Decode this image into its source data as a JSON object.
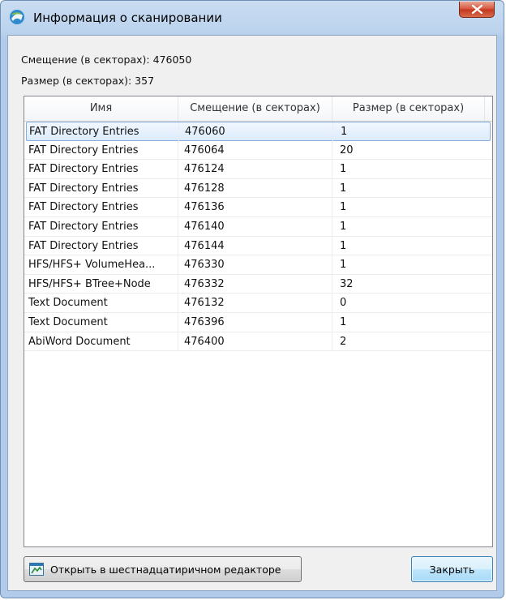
{
  "window": {
    "title": "Информация о сканировании",
    "close_icon": "close-x-icon",
    "app_icon": "scanner-app-icon"
  },
  "info": {
    "offset_line": "Смещение (в секторах): 476050",
    "size_line": "Размер (в секторах): 357"
  },
  "table": {
    "headers": [
      "Имя",
      "Смещение (в секторах)",
      "Размер (в секторах)"
    ],
    "rows": [
      {
        "name": "FAT Directory Entries",
        "offset": "476060",
        "size": "1"
      },
      {
        "name": "FAT Directory Entries",
        "offset": "476064",
        "size": "20"
      },
      {
        "name": "FAT Directory Entries",
        "offset": "476124",
        "size": "1"
      },
      {
        "name": "FAT Directory Entries",
        "offset": "476128",
        "size": "1"
      },
      {
        "name": "FAT Directory Entries",
        "offset": "476136",
        "size": "1"
      },
      {
        "name": "FAT Directory Entries",
        "offset": "476140",
        "size": "1"
      },
      {
        "name": "FAT Directory Entries",
        "offset": "476144",
        "size": "1"
      },
      {
        "name": "HFS/HFS+ VolumeHea...",
        "offset": "476330",
        "size": "1"
      },
      {
        "name": "HFS/HFS+ BTree+Node",
        "offset": "476332",
        "size": "32"
      },
      {
        "name": "Text Document",
        "offset": "476132",
        "size": "0"
      },
      {
        "name": "Text Document",
        "offset": "476396",
        "size": "1"
      },
      {
        "name": "AbiWord Document",
        "offset": "476400",
        "size": "2"
      }
    ],
    "selected_index": 0
  },
  "buttons": {
    "hex_editor_label": "Открыть в шестнадцатиричном редакторе",
    "hex_editor_icon": "hex-editor-icon",
    "close_label": "Закрыть"
  },
  "colors": {
    "selection_border": "#84acdd",
    "title_bar": "#bcd3ee",
    "close_red": "#c3361c"
  }
}
